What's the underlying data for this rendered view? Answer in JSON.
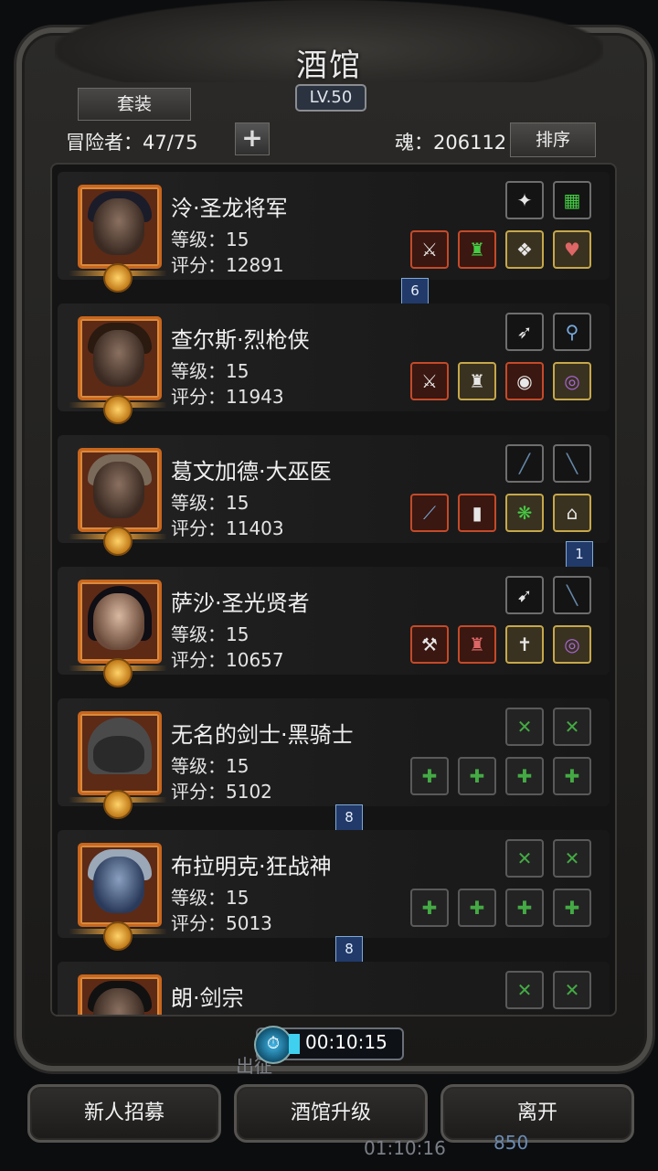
{
  "header": {
    "title": "酒馆",
    "level": "LV.50",
    "suit_label": "套装",
    "adventurer": "冒险者：47/75",
    "soul": "魂：206112",
    "sort_label": "排序",
    "plus_label": "+"
  },
  "heroes": [
    {
      "name": "泠·圣龙将军",
      "level": "等级：15",
      "score": "评分：12891",
      "badge": "6"
    },
    {
      "name": "查尔斯·烈枪侠",
      "level": "等级：15",
      "score": "评分：11943",
      "badge": ""
    },
    {
      "name": "葛文加德·大巫医",
      "level": "等级：15",
      "score": "评分：11403",
      "badge": "1"
    },
    {
      "name": "萨沙·圣光贤者",
      "level": "等级：15",
      "score": "评分：10657",
      "badge": ""
    },
    {
      "name": "无名的剑士·黑骑士",
      "level": "等级：15",
      "score": "评分：5102",
      "badge": "8"
    },
    {
      "name": "布拉明克·狂战神",
      "level": "等级：15",
      "score": "评分：5013",
      "badge": "8"
    },
    {
      "name": "朗·剑宗",
      "level": "",
      "score": "",
      "badge": ""
    }
  ],
  "timer": "00:10:15",
  "buttons": {
    "recruit": "新人招募",
    "upgrade": "酒馆升级",
    "leave": "离开"
  },
  "background": {
    "expedition": "出征",
    "time": "01:10:16",
    "count": "850"
  }
}
